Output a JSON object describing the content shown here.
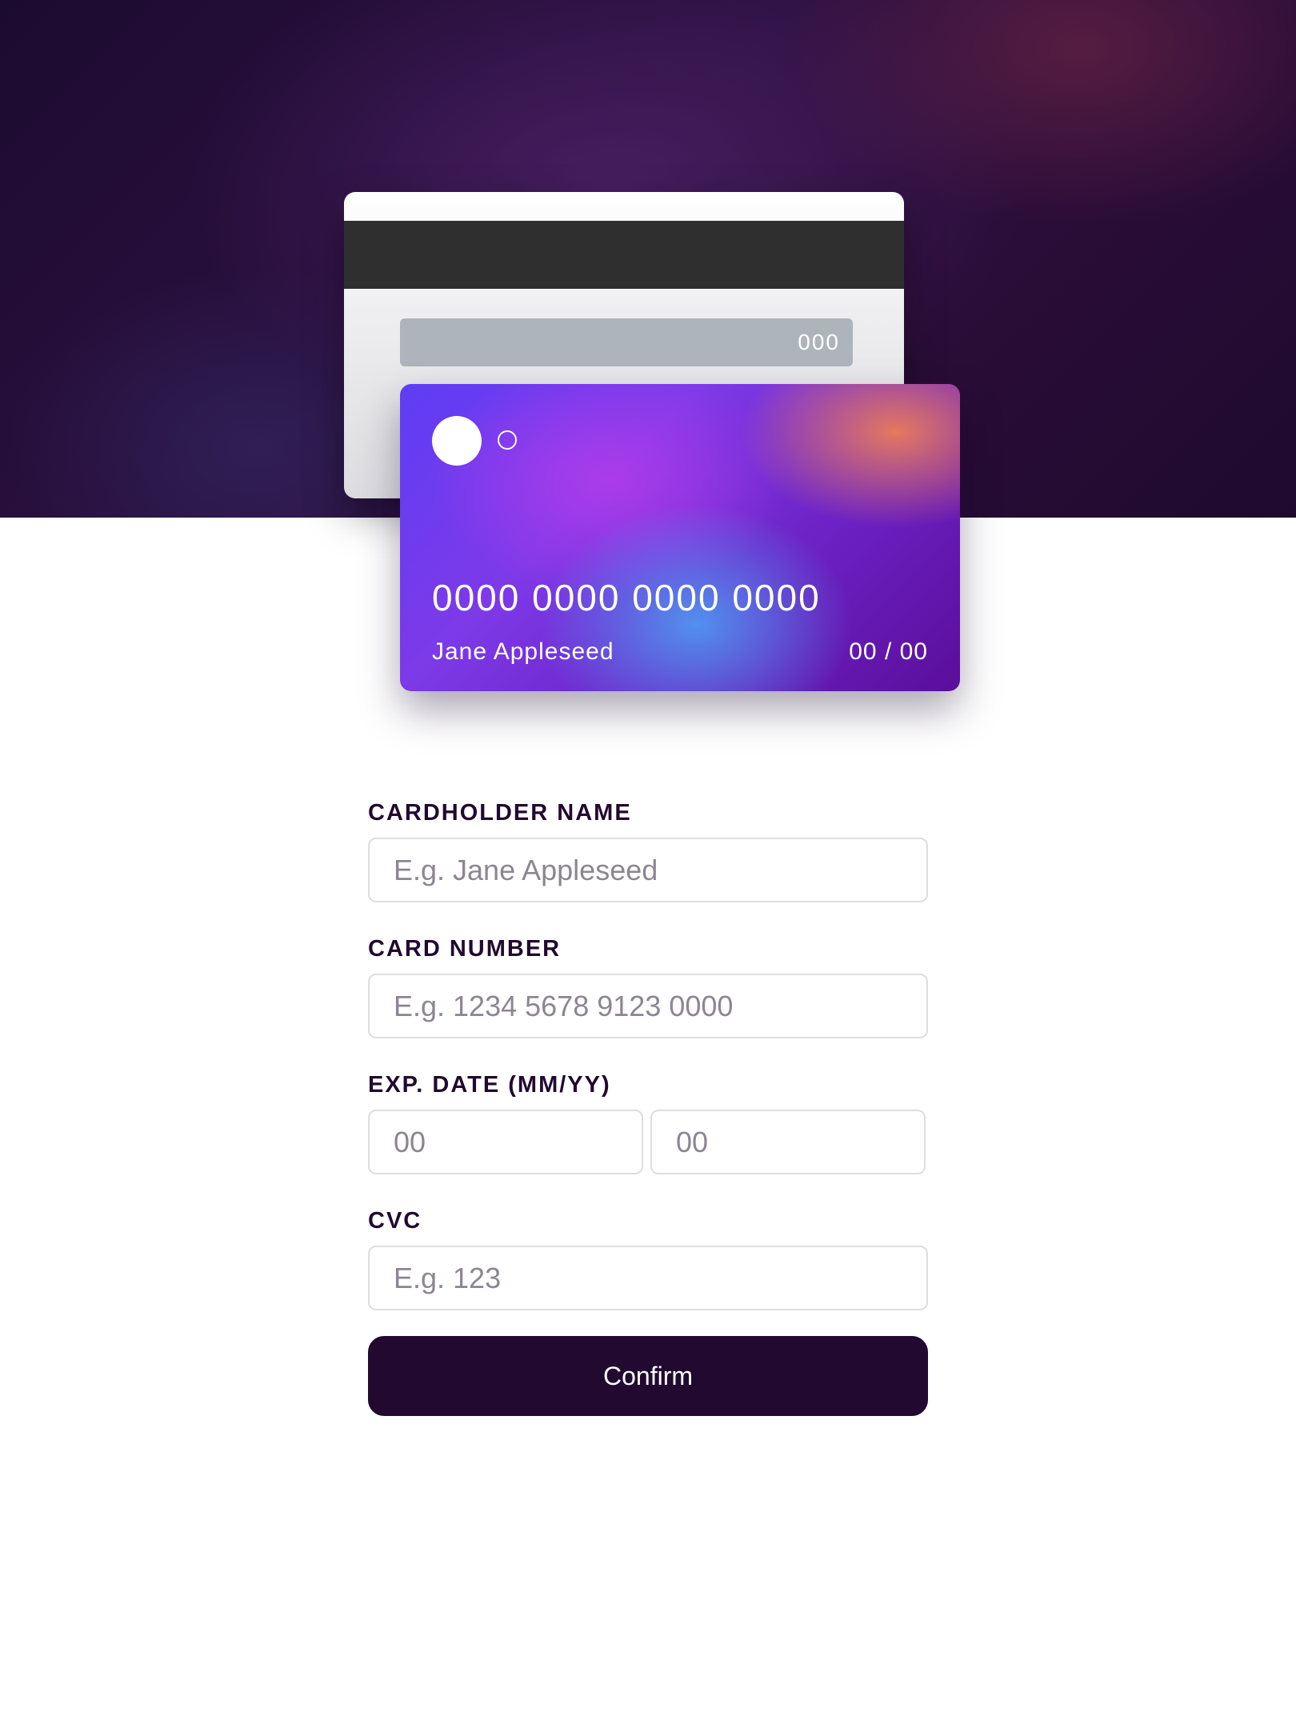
{
  "card_back": {
    "cvc": "000"
  },
  "card_front": {
    "number": "0000 0000 0000 0000",
    "holder": "Jane Appleseed",
    "expiry": "00 / 00"
  },
  "form": {
    "cardholder": {
      "label": "CARDHOLDER NAME",
      "placeholder": "E.g. Jane Appleseed"
    },
    "card_number": {
      "label": "CARD NUMBER",
      "placeholder": "E.g. 1234 5678 9123 0000"
    },
    "exp_date": {
      "label": "EXP. DATE (MM/YY)",
      "month_placeholder": "00",
      "year_placeholder": "00"
    },
    "cvc": {
      "label": "CVC",
      "placeholder": "E.g. 123"
    },
    "confirm_label": "Confirm"
  },
  "colors": {
    "dark_violet": "#21092f",
    "input_border": "#dedddf",
    "placeholder": "#8e8593"
  }
}
